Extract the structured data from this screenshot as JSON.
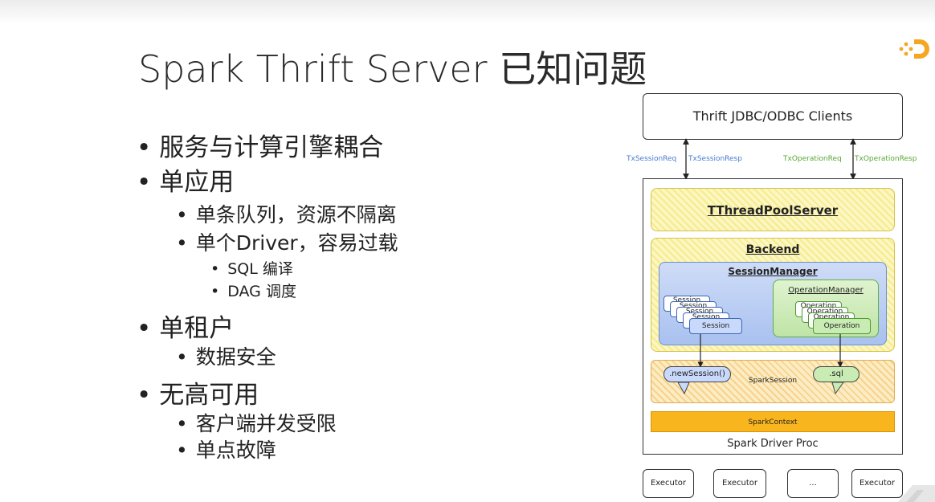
{
  "slide": {
    "title": "Spark Thrift Server 已知问题",
    "bullets": [
      {
        "level": 1,
        "text": "服务与计算引擎耦合"
      },
      {
        "level": 1,
        "text": "单应用"
      },
      {
        "level": 2,
        "text": "单条队列，资源不隔离"
      },
      {
        "level": 2,
        "text": "单个Driver，容易过载"
      },
      {
        "level": 3,
        "text": "SQL 编译"
      },
      {
        "level": 3,
        "text": "DAG 调度"
      },
      {
        "level": 1,
        "text": "单租户"
      },
      {
        "level": 2,
        "text": "数据安全"
      },
      {
        "level": 1,
        "text": "无高可用"
      },
      {
        "level": 2,
        "text": "客户端并发受限"
      },
      {
        "level": 2,
        "text": "单点故障"
      }
    ],
    "bullet_char": "•"
  },
  "diagram": {
    "clients": "Thrift JDBC/ODBC Clients",
    "msg_session_req": "TxSessionReq",
    "msg_session_resp": "TxSessionResp",
    "msg_operation_req": "TxOperationReq",
    "msg_operation_resp": "TxOperationResp",
    "thread_pool": "TThreadPoolServer",
    "backend": "Backend",
    "session_manager": "SessionManager",
    "operation_manager": "OperationManager",
    "session_front": "Session",
    "session_back": "Session",
    "operation_front": "Operation",
    "operation_back": "Operation",
    "new_session": ".newSession()",
    "sql": ".sql",
    "spark_session": "SparkSession",
    "spark_context": "SparkContext",
    "driver": "Spark Driver Proc",
    "executors": [
      "Executor",
      "Executor",
      "...",
      "Executor"
    ]
  },
  "colors": {
    "session_blue": "#a9c1f0",
    "operation_green": "#bfe4a6",
    "context_orange": "#f9b51d",
    "pool_yellow": "#f6ec8a",
    "logo_orange": "#f5a623"
  }
}
